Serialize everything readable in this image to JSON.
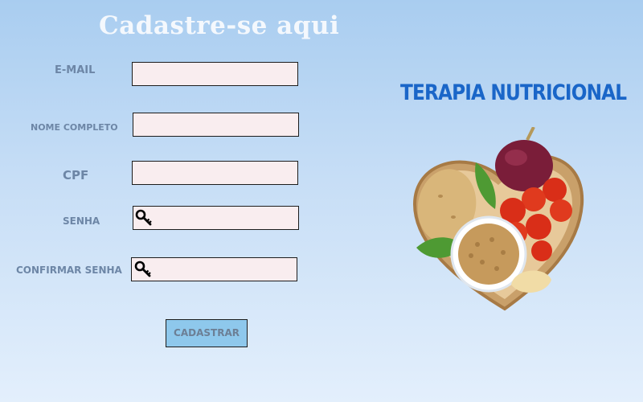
{
  "form": {
    "title": "Cadastre-se aqui",
    "email_label": "E-MAIL",
    "name_label": "NOME COMPLETO",
    "cpf_label": "CPF",
    "password_label": "SENHA",
    "confirm_label": "CONFIRMAR SENHA",
    "email_value": "",
    "name_value": "",
    "cpf_value": "",
    "password_value": "",
    "confirm_value": "",
    "submit_label": "CADASTRAR"
  },
  "brand": {
    "title": "TERAPIA NUTRICIONAL"
  },
  "icons": {
    "password": "key-icon",
    "confirm": "key-icon"
  },
  "colors": {
    "background_top": "#a9cdf0",
    "background_bottom": "#e3effc",
    "field_fill": "#f9edef",
    "label": "#6d86a6",
    "brand": "#1a66c8",
    "button": "#8ec8ec"
  }
}
